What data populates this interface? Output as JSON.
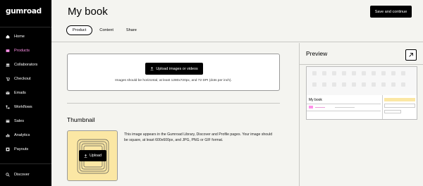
{
  "sidebar": {
    "logo": "gumroad",
    "items": [
      {
        "label": "Home",
        "icon": "home-icon"
      },
      {
        "label": "Products",
        "icon": "products-icon",
        "active": true
      },
      {
        "label": "Collaborators",
        "icon": "collaborators-icon"
      },
      {
        "label": "Checkout",
        "icon": "cart-icon"
      },
      {
        "label": "Emails",
        "icon": "mail-icon"
      },
      {
        "label": "Workflows",
        "icon": "workflows-icon"
      },
      {
        "label": "Sales",
        "icon": "sales-icon"
      },
      {
        "label": "Analytics",
        "icon": "bar-chart-icon"
      },
      {
        "label": "Payouts",
        "icon": "payouts-icon"
      }
    ],
    "discover": {
      "label": "Discover",
      "icon": "search-icon"
    }
  },
  "header": {
    "title": "My book",
    "save_label": "Save and continue",
    "tabs": [
      {
        "label": "Product",
        "active": true
      },
      {
        "label": "Content"
      },
      {
        "label": "Share"
      }
    ]
  },
  "cover": {
    "upload_label": "Upload images or videos",
    "hint": "Images should be horizontal, at least 1280x720px, and 72 DPI (dots per inch)."
  },
  "thumbnail": {
    "title": "Thumbnail",
    "upload_label": "Upload",
    "description": "This image appears in the Gumroad Library, Discover and Profile pages. Your image should be square, at least 600x600px, and JPG, PNG or GIF format."
  },
  "preview": {
    "title": "Preview",
    "product_title": "My book"
  },
  "colors": {
    "accent": "#ff90e8",
    "thumbnail_bg": "#fbe7a4"
  }
}
